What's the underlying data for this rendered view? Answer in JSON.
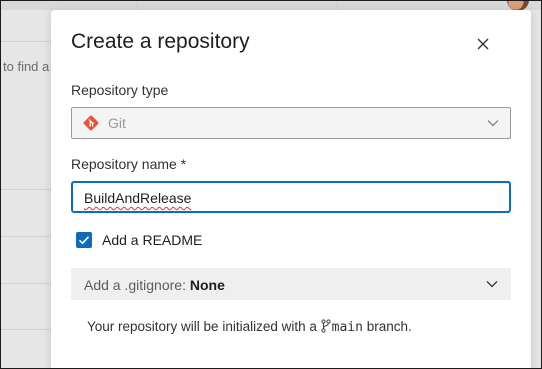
{
  "background": {
    "partial_text": "to find a"
  },
  "dialog": {
    "title": "Create a repository",
    "repo_type": {
      "label": "Repository type",
      "value": "Git",
      "icon": "git-icon"
    },
    "repo_name": {
      "label": "Repository name *",
      "value": "BuildAndRelease"
    },
    "readme": {
      "label": "Add a README",
      "checked": true
    },
    "gitignore": {
      "prefix": "Add a .gitignore: ",
      "value": "None"
    },
    "info": {
      "before": "Your repository will be initialized with a ",
      "branch": "main",
      "after": " branch."
    }
  },
  "colors": {
    "accent": "#0f6cbd",
    "git_orange": "#e8543a"
  }
}
